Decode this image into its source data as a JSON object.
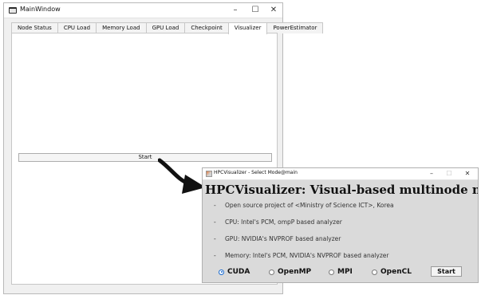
{
  "main_window": {
    "title": "MainWindow",
    "controls": {
      "minimize": "–",
      "maximize": "☐",
      "close": "✕"
    },
    "tabs": [
      {
        "label": "Node Status",
        "active": false
      },
      {
        "label": "CPU Load",
        "active": false
      },
      {
        "label": "Memory Load",
        "active": false
      },
      {
        "label": "GPU Load",
        "active": false
      },
      {
        "label": "Checkpoint",
        "active": false
      },
      {
        "label": "Visualizer",
        "active": true
      },
      {
        "label": "PowerEstimator",
        "active": false
      }
    ],
    "start_button": "Start"
  },
  "dialog": {
    "title": "HPCVisualizer - Select Mode@main",
    "controls": {
      "minimize": "–",
      "maximize": "☐",
      "close": "✕"
    },
    "headline": "HPCVisualizer: Visual-based multinode node ...",
    "bullets": [
      "Open source project of <Ministry of Science ICT>, Korea",
      "CPU: Intel's PCM, ompP based analyzer",
      "GPU: NVIDIA's NVPROF based analyzer",
      "Memory: Intel's PCM, NVIDIA's NVPROF based analyzer"
    ],
    "bullet_dash": "-",
    "modes": [
      {
        "label": "CUDA",
        "checked": true
      },
      {
        "label": "OpenMP",
        "checked": false
      },
      {
        "label": "MPI",
        "checked": false
      },
      {
        "label": "OpenCL",
        "checked": false
      }
    ],
    "start_button": "Start"
  },
  "colors": {
    "window_bg": "#f0f0f0",
    "dialog_bg": "#dadada",
    "radio_accent": "#1a6bd0",
    "arrow": "#111111"
  }
}
